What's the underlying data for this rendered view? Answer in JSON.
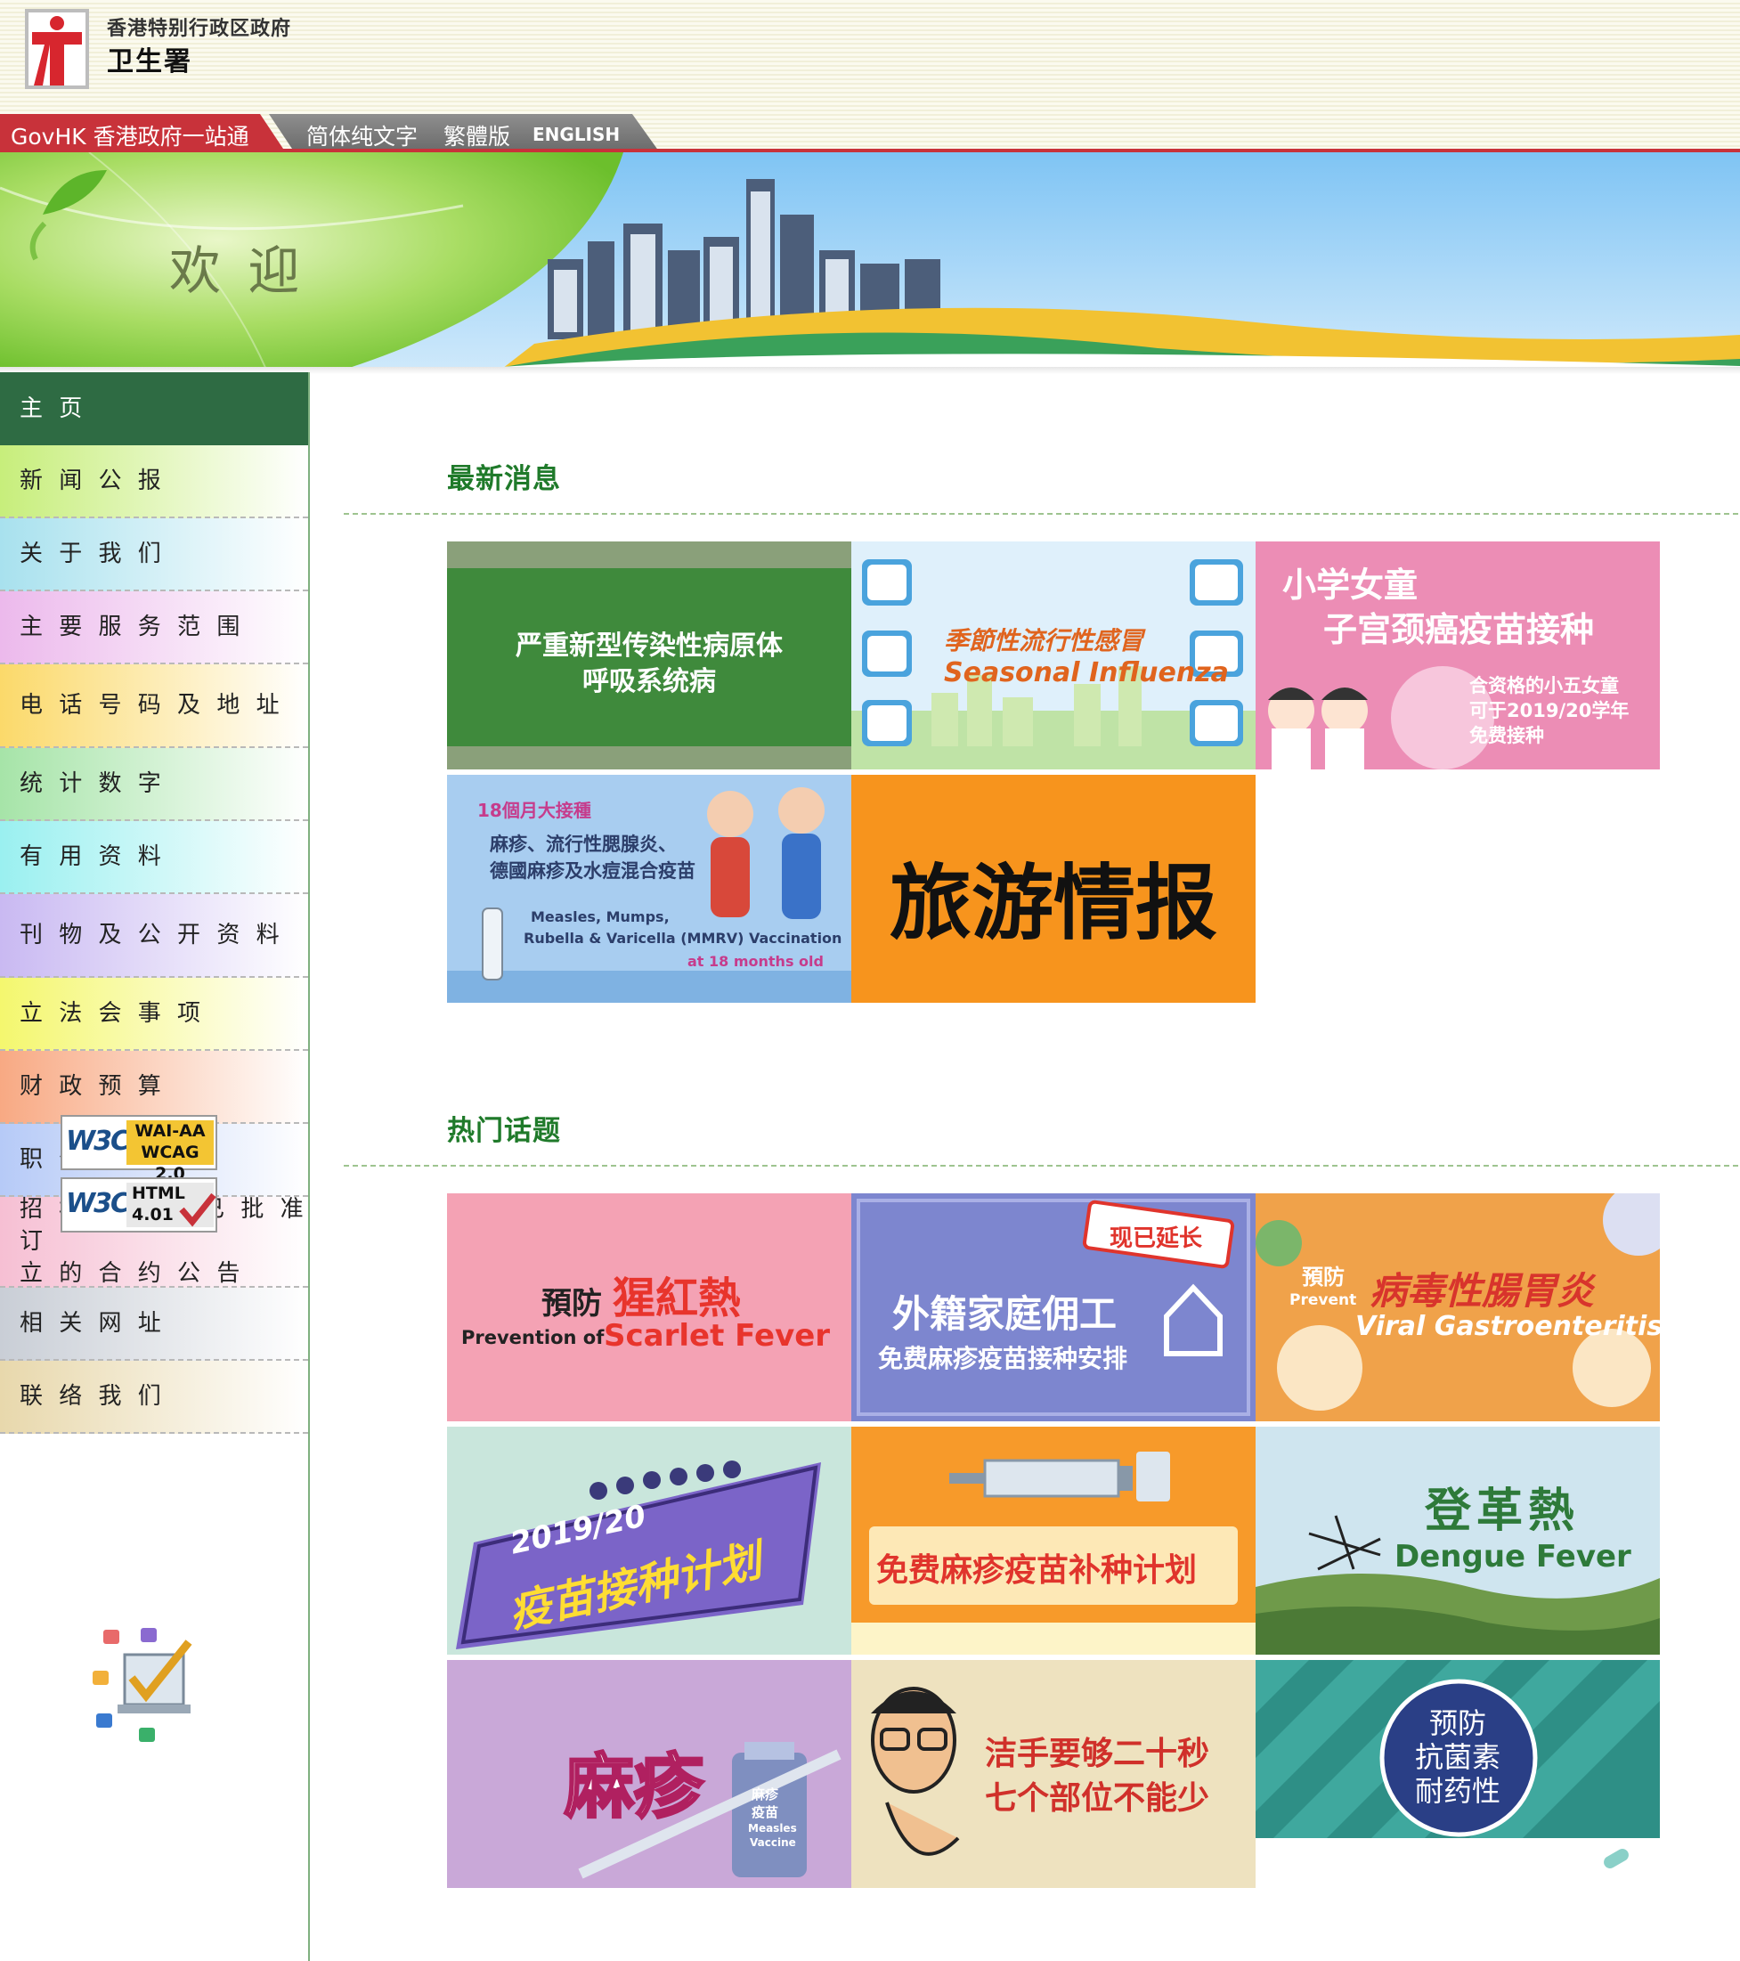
{
  "header": {
    "gov_name": "香港特别行政区政府",
    "dept_name": "卫生署",
    "govhk": "GovHK 香港政府一站通",
    "lang_text_only": "简体纯文字",
    "lang_traditional": "繁體版",
    "lang_english": "ENGLISH"
  },
  "banner": {
    "welcome": "欢 迎"
  },
  "sidebar": {
    "items": [
      "主 页",
      "新 闻 公 报",
      "关 于 我 们",
      "主 要 服 务 范 围",
      "电 话 号 码 及 地 址",
      "统 计 数 字",
      "有 用 资 料",
      "刊 物 及 公 开 资 料",
      "立 法 会 事 项",
      "财 政 预 算",
      "职 位 空 缺",
      "招 标 公 告 / 已 批 准 订",
      "立 的 合 约 公 告",
      "相 关 网 址",
      "联 络 我 们"
    ],
    "badge_wcag": {
      "w3c": "W3C",
      "line1": "WAI-AA",
      "line2": "WCAG 2.0"
    },
    "badge_html": {
      "w3c": "W3C",
      "line1": "HTML",
      "line2": "4.01"
    }
  },
  "news": {
    "title": "最新消息",
    "tiles": [
      {
        "line1": "严重新型传染性病原体",
        "line2": "呼吸系统病"
      },
      {
        "line1": "季節性流行性感冒",
        "line2": "Seasonal Influenza"
      },
      {
        "line1": "小学女童",
        "line2": "子宫颈癌疫苗接种",
        "line3": "合资格的小五女童",
        "line4": "可于2019/20学年",
        "line5": "免费接种"
      },
      {
        "line1": "18個月大接種",
        "line2": "麻疹、流行性腮腺炎、",
        "line3": "德國麻疹及水痘混合疫苗",
        "line4": "Measles, Mumps,",
        "line5": "Rubella & Varicella (MMRV) Vaccination",
        "line6": "at 18 months old"
      },
      {
        "line1": "旅游情报"
      }
    ]
  },
  "topics": {
    "title": "热门话题",
    "tiles": [
      {
        "line1": "預防",
        "line2": "猩紅熱",
        "line3": "Prevention of",
        "line4": "Scarlet Fever"
      },
      {
        "stamp": "现已延长",
        "line1": "外籍家庭佣工",
        "line2": "免费麻疹疫苗接种安排"
      },
      {
        "line1": "預防",
        "line2": "Prevent",
        "line3": "病毒性腸胃炎",
        "line4": "Viral Gastroenteritis"
      },
      {
        "line1": "2019/20",
        "line2": "疫苗接种计划"
      },
      {
        "line1": "免费麻疹疫苗补种计划"
      },
      {
        "line1": "登革熱",
        "line2": "Dengue Fever"
      },
      {
        "line1": "麻疹",
        "line2": "麻疹",
        "line3": "疫苗",
        "line4": "Measles",
        "line5": "Vaccine"
      },
      {
        "line1": "洁手要够二十秒",
        "line2": "七个部位不能少"
      },
      {
        "line1": "预防",
        "line2": "抗菌素",
        "line3": "耐药性"
      }
    ]
  },
  "colors": {
    "brand_red": "#c8323a",
    "nav_home": "#2e6b43",
    "section_title": "#1f7a2a"
  }
}
